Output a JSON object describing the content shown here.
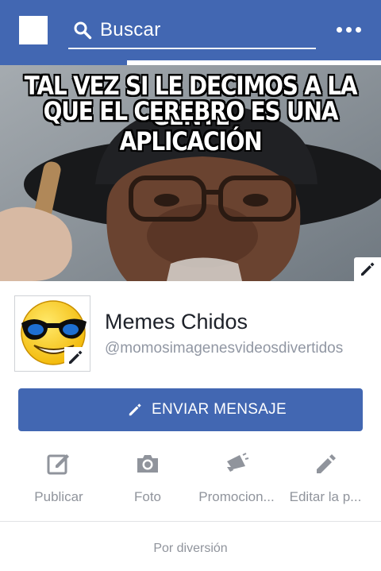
{
  "topbar": {
    "search_placeholder": "Buscar",
    "home_icon": "home-square-icon",
    "menu_icon": "more-dots-icon"
  },
  "cover": {
    "caption_line1": "TAL VEZ SI LE DECIMOS A LA GENTE",
    "caption_line2": "QUE EL CEREBRO ES UNA APLICACIÓN",
    "edit_icon": "pencil-icon"
  },
  "profile": {
    "name": "Memes Chidos",
    "handle": "@momosimagenesvideosdivertidos",
    "avatar_icon": "sunglasses-emoji-avatar"
  },
  "message_button": {
    "label": "ENVIAR MENSAJE",
    "icon": "pencil-icon"
  },
  "actions": [
    {
      "label": "Publicar",
      "icon": "compose-icon"
    },
    {
      "label": "Foto",
      "icon": "camera-icon"
    },
    {
      "label": "Promocion...",
      "icon": "megaphone-icon"
    },
    {
      "label": "Editar la p...",
      "icon": "pencil-icon"
    }
  ],
  "about": {
    "text": "Por diversión"
  },
  "colors": {
    "brand": "#4267b2",
    "muted_text": "#90949c",
    "title_text": "#1d2129"
  }
}
